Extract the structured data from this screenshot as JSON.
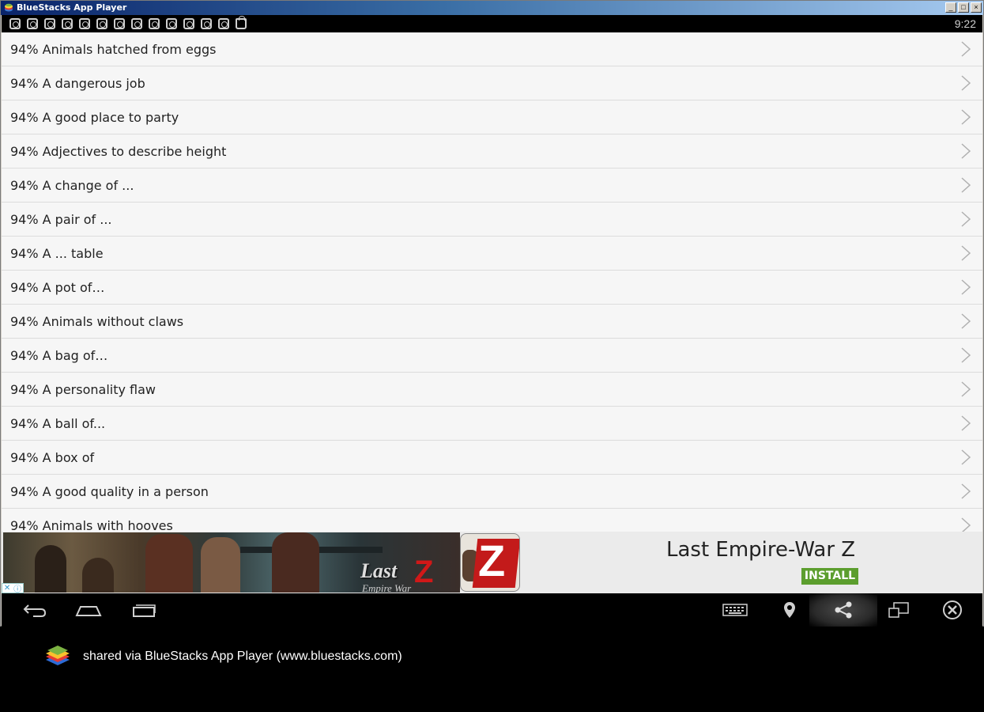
{
  "window": {
    "title": "BlueStacks App Player",
    "buttons": {
      "minimize": "_",
      "maximize": "□",
      "close": "×"
    }
  },
  "statusbar": {
    "notification_icons": [
      "instagram-icon",
      "instagram-icon",
      "instagram-icon",
      "instagram-icon",
      "instagram-icon",
      "instagram-icon",
      "instagram-icon",
      "instagram-icon",
      "instagram-icon",
      "instagram-icon",
      "instagram-icon",
      "instagram-icon",
      "instagram-icon",
      "shopping-bag-icon"
    ],
    "clock": "9:22"
  },
  "list": {
    "items": [
      {
        "label": "94% Animals hatched from eggs"
      },
      {
        "label": "94% A dangerous job"
      },
      {
        "label": "94% A good place to party"
      },
      {
        "label": "94% Adjectives to describe height"
      },
      {
        "label": "94% A change of ..."
      },
      {
        "label": "94% A pair of ..."
      },
      {
        "label": "94% A ... table"
      },
      {
        "label": "94% A pot of…"
      },
      {
        "label": "94% Animals without claws"
      },
      {
        "label": "94% A bag of…"
      },
      {
        "label": "94% A personality flaw"
      },
      {
        "label": "94% A ball of..."
      },
      {
        "label": "94% A box of"
      },
      {
        "label": "94% A good quality in a person"
      },
      {
        "label": "94% Animals with hooves"
      }
    ]
  },
  "ad": {
    "banner_text": "Last",
    "banner_letter": "Z",
    "banner_subtext": "Empire War",
    "app_icon_letter": "Z",
    "title": "Last Empire-War Z",
    "install_label": "INSTALL",
    "adchoices_close": "✕",
    "adchoices_info": "ⓘ",
    "install_color": "#5c9e2e"
  },
  "navbar": {
    "left": [
      "back-icon",
      "home-icon",
      "recent-apps-icon"
    ],
    "right": [
      "keyboard-icon",
      "location-icon",
      "share-icon",
      "rotate-icon",
      "close-app-icon"
    ]
  },
  "footer": {
    "text": "shared via BlueStacks App Player (www.bluestacks.com)"
  }
}
